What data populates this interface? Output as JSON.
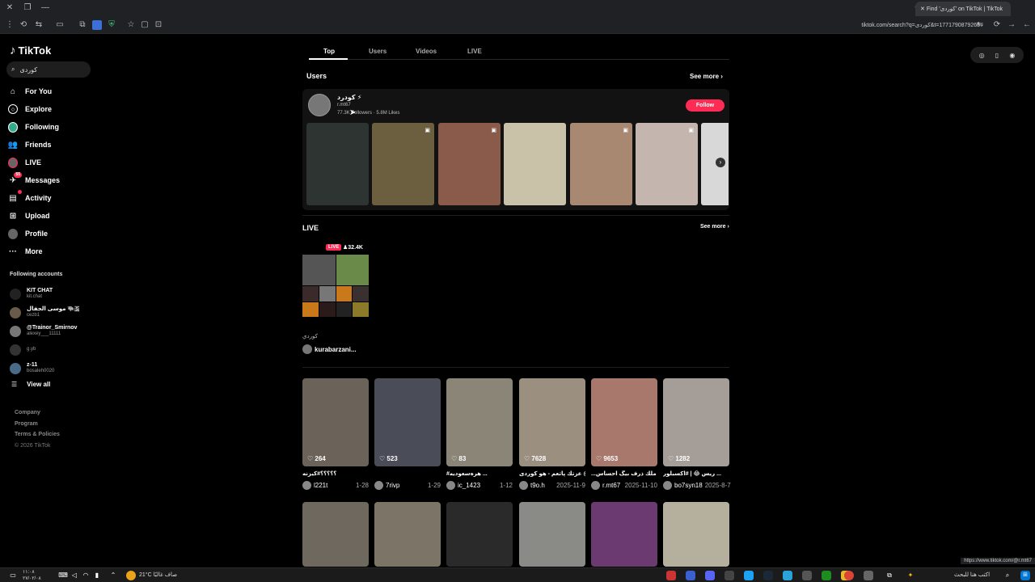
{
  "browser": {
    "tab_title": "Find 'کوردی' on TikTok | TikTok",
    "url": "tiktok.com/search?q=کوردی&t=1771790879265",
    "status_link": "https://www.tiktok.com/@r.mt67"
  },
  "sidebar": {
    "logo": "TikTok",
    "search_value": "کوردی",
    "nav": [
      {
        "label": "For You",
        "icon": "home-icon"
      },
      {
        "label": "Explore",
        "icon": "compass-icon"
      },
      {
        "label": "Following",
        "icon": "following-icon"
      },
      {
        "label": "Friends",
        "icon": "friends-icon"
      },
      {
        "label": "LIVE",
        "icon": "live-icon"
      },
      {
        "label": "Messages",
        "icon": "messages-icon",
        "badge": "55"
      },
      {
        "label": "Activity",
        "icon": "activity-icon"
      },
      {
        "label": "Upload",
        "icon": "upload-icon"
      },
      {
        "label": "Profile",
        "icon": "profile-icon"
      },
      {
        "label": "More",
        "icon": "more-icon"
      }
    ],
    "following_title": "Following accounts",
    "following": [
      {
        "name": "KIT CHAT",
        "handle": "kit.chat"
      },
      {
        "name": "موسی الجفال 🐃🇸",
        "handle": "cezb1"
      },
      {
        "name": "@Trainor_Smirnov",
        "handle": "alexey___11111"
      },
      {
        "name": "",
        "handle": "g.yb"
      },
      {
        "name": "z-11",
        "handle": "bosaleh0020"
      }
    ],
    "view_all": "View all",
    "footer": [
      "Company",
      "Program",
      "Terms & Policies"
    ],
    "copyright": "© 2026 TikTok"
  },
  "tabs": [
    "Top",
    "Users",
    "Videos",
    "LIVE"
  ],
  "users_section": {
    "title": "Users",
    "see_more": "See more",
    "user": {
      "name": "كودرد ⚡",
      "handle": "r.mt67",
      "followers": "77.3K Followers",
      "likes": "5.8M Likes",
      "follow_label": "Follow"
    }
  },
  "live_section": {
    "title": "LIVE",
    "see_more": "See more",
    "badge": "LIVE",
    "viewers": "32.4K",
    "stream_title": "كوردي",
    "user": "kurabarzani..."
  },
  "videos": [
    {
      "likes": "264",
      "caption": "؟؟؟؟؟#کیزنه",
      "user": "l221t",
      "date": "1-28",
      "color": "#6b6259"
    },
    {
      "likes": "523",
      "caption": "",
      "user": "7rivp",
      "date": "1-29",
      "color": "#4a4c57"
    },
    {
      "likes": "83",
      "caption": "#هرەسعودیە ...",
      "user": "ic_1423",
      "date": "1-12",
      "color": "#8a8576"
    },
    {
      "likes": "7628",
      "caption": "عزتك پاتعم - هو کوردی @ ...",
      "user": "t9o.h",
      "date": "2025-11-9",
      "color": "#9b8f80"
    },
    {
      "likes": "9653",
      "caption": "...ملك ذرف بيگ احساس",
      "user": "r.mt67",
      "date": "2025-11-10",
      "color": "#a8786c"
    },
    {
      "likes": "1282",
      "caption": "ريس 😂 | #اكسبلور ...",
      "user": "bo7syn18",
      "date": "2025-8-7",
      "color": "#a59d98"
    }
  ],
  "videos_row2": [
    {
      "color": "#6f685e"
    },
    {
      "color": "#7d7468"
    },
    {
      "color": "#2a2a2a"
    },
    {
      "color": "#8a8a86"
    },
    {
      "color": "#6a3a70"
    },
    {
      "color": "#b5b09e"
    }
  ],
  "user_thumb_colors": [
    "#2e3431",
    "#6b5f3f",
    "#8a5a4a",
    "#c9c2a8",
    "#a88870",
    "#c4b5ae",
    "#d8d8d8"
  ],
  "taskbar": {
    "time": "١١:٠٨",
    "date": "٢٧/٠٢/٠٨",
    "weather": "21°C صاف غالبًا",
    "search_placeholder": "اكتب هنا للبحث"
  }
}
